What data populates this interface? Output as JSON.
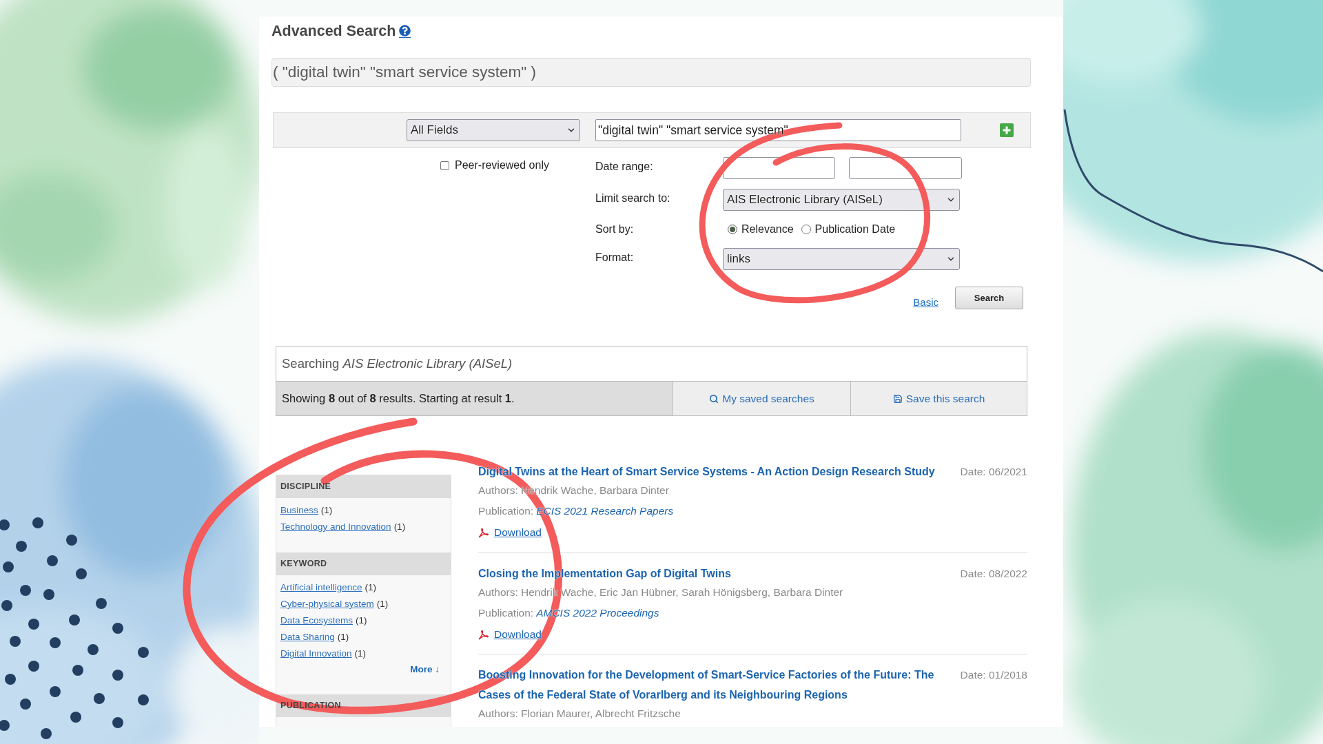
{
  "page": {
    "title": "Advanced Search"
  },
  "query_summary": "( \"digital twin\" \"smart service system\" )",
  "search_row": {
    "field": "All Fields",
    "value": "\"digital twin\" \"smart service system\""
  },
  "peer_reviewed": {
    "label": "Peer-reviewed only",
    "checked": false
  },
  "date_range": {
    "label": "Date range:"
  },
  "limit": {
    "label": "Limit search to:",
    "value": "AIS Electronic Library (AISeL)"
  },
  "sort": {
    "label": "Sort by:",
    "options": [
      {
        "label": "Relevance",
        "selected": true
      },
      {
        "label": "Publication Date",
        "selected": false
      }
    ]
  },
  "format": {
    "label": "Format:",
    "value": "links"
  },
  "actions": {
    "basic": "Basic",
    "search": "Search"
  },
  "searching": {
    "text": "Searching *AIS Electronic Library (AISeL)*",
    "summary": "Showing **8** out of **8** results. Starting at result **1**.",
    "my_saved_searches": "My saved searches",
    "save_search": "Save this search"
  },
  "facets": [
    {
      "title": "DISCIPLINE",
      "items": [
        {
          "label": "Business",
          "count": "(1)"
        },
        {
          "label": "Technology and Innovation",
          "count": "(1)"
        }
      ]
    },
    {
      "title": "KEYWORD",
      "items": [
        {
          "label": "Artificial intelligence",
          "count": "(1)"
        },
        {
          "label": "Cyber-physical system",
          "count": "(1)"
        },
        {
          "label": "Data Ecosystems",
          "count": "(1)"
        },
        {
          "label": "Data Sharing",
          "count": "(1)"
        },
        {
          "label": "Digital Innovation",
          "count": "(1)"
        }
      ],
      "more": "More ↓"
    },
    {
      "title": "PUBLICATION"
    }
  ],
  "results": [
    {
      "title": "Digital Twins at the Heart of Smart Service Systems - An Action Design Research Study",
      "date": "Date: 06/2021",
      "authors": "Authors: Hendrik Wache, Barbara Dinter",
      "publication_label": "Publication:",
      "publication": "ECIS 2021 Research Papers",
      "download": "Download"
    },
    {
      "title": "Closing the Implementation Gap of Digital Twins",
      "date": "Date: 08/2022",
      "authors": "Authors: Hendrik Wache, Eric Jan Hübner, Sarah Hönigsberg, Barbara Dinter",
      "publication_label": "Publication:",
      "publication": "AMCIS 2022 Proceedings",
      "download": "Download"
    },
    {
      "title": "Boosting Innovation for the Development of Smart-Service Factories of the Future: The Cases of the Federal State of Vorarlberg and its Neighbouring Regions",
      "date": "Date: 01/2018",
      "authors": "Authors: Florian Maurer, Albrecht Fritzsche"
    }
  ]
}
